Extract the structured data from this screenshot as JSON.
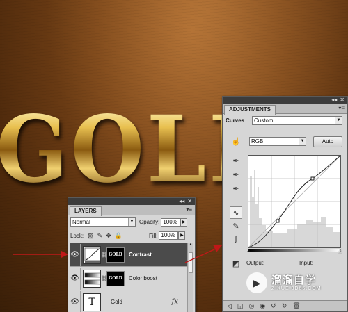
{
  "artwork": {
    "text": "GOLD"
  },
  "layers_panel": {
    "tab_label": "LAYERS",
    "blend_mode": "Normal",
    "opacity_label": "Opacity:",
    "opacity_value": "100%",
    "lock_label": "Lock:",
    "fill_label": "Fill:",
    "fill_value": "100%",
    "layers": [
      {
        "name": "Contrast",
        "selected": true,
        "mask_text": "GOLD",
        "icon": "curves-adjustment-icon"
      },
      {
        "name": "Color boost",
        "selected": false,
        "mask_text": "GOLD",
        "icon": "gradient-map-icon"
      },
      {
        "name": "Gold",
        "selected": false,
        "thumb_text": "T",
        "fx_label": "fx",
        "icon": "type-layer-icon"
      }
    ]
  },
  "adjustments_panel": {
    "tab_label": "ADJUSTMENTS",
    "adjustment_name": "Curves",
    "preset": "Custom",
    "channel": "RGB",
    "auto_label": "Auto",
    "output_label": "Output:",
    "input_label": "Input:"
  },
  "watermark": {
    "main": "溜溜自学",
    "sub": "ZIXUE.3D66.COM"
  },
  "colors": {
    "arrow": "#c01818",
    "selected_layer": "#4b4b4b",
    "panel_bg": "#d6d6d6"
  }
}
